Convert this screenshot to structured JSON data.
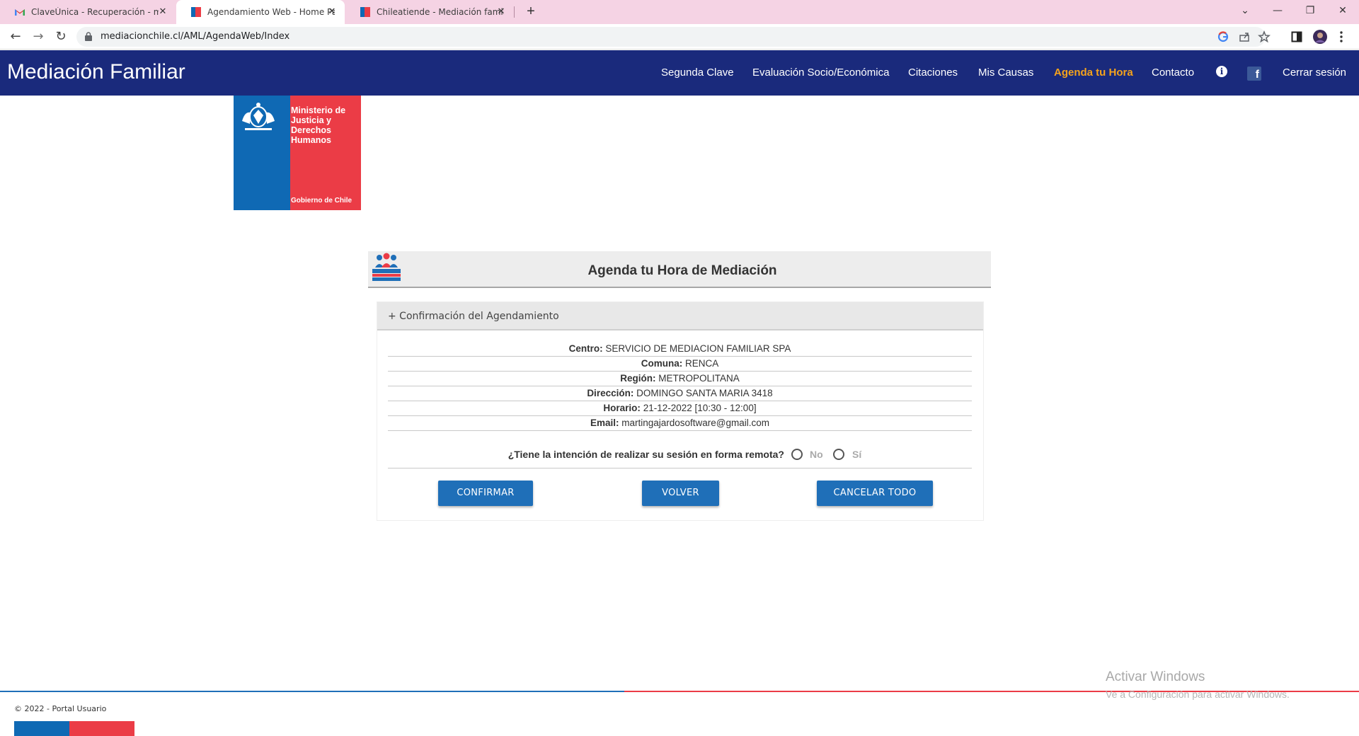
{
  "browser": {
    "tabs": [
      {
        "title": "ClaveÚnica - Recuperación - mar",
        "close": "✕"
      },
      {
        "title": "Agendamiento Web - Home Pag",
        "close": "✕"
      },
      {
        "title": "Chileatiende - Mediación familia",
        "close": "✕"
      }
    ],
    "new_tab": "+",
    "url": "mediacionchile.cl/AML/AgendaWeb/Index",
    "window_controls": {
      "tab_search": "⌄",
      "minimize": "—",
      "restore": "❐",
      "close": "✕"
    },
    "nav": {
      "back": "←",
      "forward": "→",
      "reload": "↻"
    },
    "icons": [
      "google-icon",
      "share-icon",
      "star-icon",
      "sidepanel-icon",
      "profile-avatar",
      "kebab-menu-icon"
    ]
  },
  "site": {
    "brand": "Mediación Familiar",
    "nav": {
      "segunda_clave": "Segunda Clave",
      "evaluacion": "Evaluación Socio/Económica",
      "citaciones": "Citaciones",
      "mis_causas": "Mis Causas",
      "agenda": "Agenda tu Hora",
      "contacto": "Contacto",
      "info_icon": "i",
      "facebook_icon": "f",
      "cerrar": "Cerrar sesión"
    },
    "accent": "#f6a31b",
    "nav_bg": "#1a2a7c"
  },
  "gov_logo": {
    "ministry": "Ministerio de Justicia y Derechos Humanos",
    "gobierno": "Gobierno de Chile"
  },
  "panel": {
    "title": "Agenda tu Hora de Mediación",
    "section": "+ Confirmación del Agendamiento",
    "rows": [
      {
        "label": "Centro:",
        "value": "SERVICIO DE MEDIACION FAMILIAR SPA"
      },
      {
        "label": "Comuna:",
        "value": "RENCA"
      },
      {
        "label": "Región:",
        "value": "METROPOLITANA"
      },
      {
        "label": "Dirección:",
        "value": "DOMINGO SANTA MARIA 3418"
      },
      {
        "label": "Horario:",
        "value": "21-12-2022 [10:30 - 12:00]"
      },
      {
        "label": "Email:",
        "value": "martingajardosoftware@gmail.com"
      }
    ],
    "question": "¿Tiene la intención de realizar su sesión en forma remota?",
    "option_no": "No",
    "option_si": "Sí",
    "buttons": {
      "confirmar": "CONFIRMAR",
      "volver": "VOLVER",
      "cancelar": "CANCELAR TODO"
    }
  },
  "footer": {
    "copyright": "© 2022 - Portal Usuario"
  },
  "watermark": {
    "line1": "Activar Windows",
    "line2": "Ve a Configuración para activar Windows."
  }
}
